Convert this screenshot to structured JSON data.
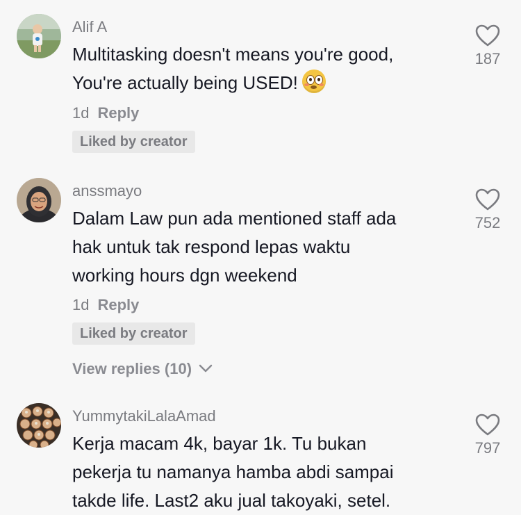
{
  "comments": [
    {
      "username": "Alif A",
      "text": "Multitasking doesn't means you're good,\nYou're actually being USED!",
      "emoji": "flushed-face-emoji",
      "time": "1d",
      "reply_label": "Reply",
      "liked_badge": "Liked by creator",
      "likes": "187"
    },
    {
      "username": "anssmayo",
      "text": "Dalam Law pun ada mentioned staff ada\nhak untuk tak respond lepas waktu\nworking hours dgn weekend",
      "time": "1d",
      "reply_label": "Reply",
      "liked_badge": "Liked by creator",
      "likes": "752",
      "view_replies": "View replies (10)"
    },
    {
      "username": "YummytakiLalaAmad",
      "text": "Kerja macam 4k, bayar 1k. Tu bukan\npekerja tu namanya hamba abdi sampai\ntakde life. Last2 aku jual takoyaki, setel.",
      "likes": "797"
    }
  ],
  "colors": {
    "background": "#f7f7f7",
    "text": "#161823",
    "secondary": "#7a7b80",
    "badge_bg": "#e8e8e8"
  }
}
